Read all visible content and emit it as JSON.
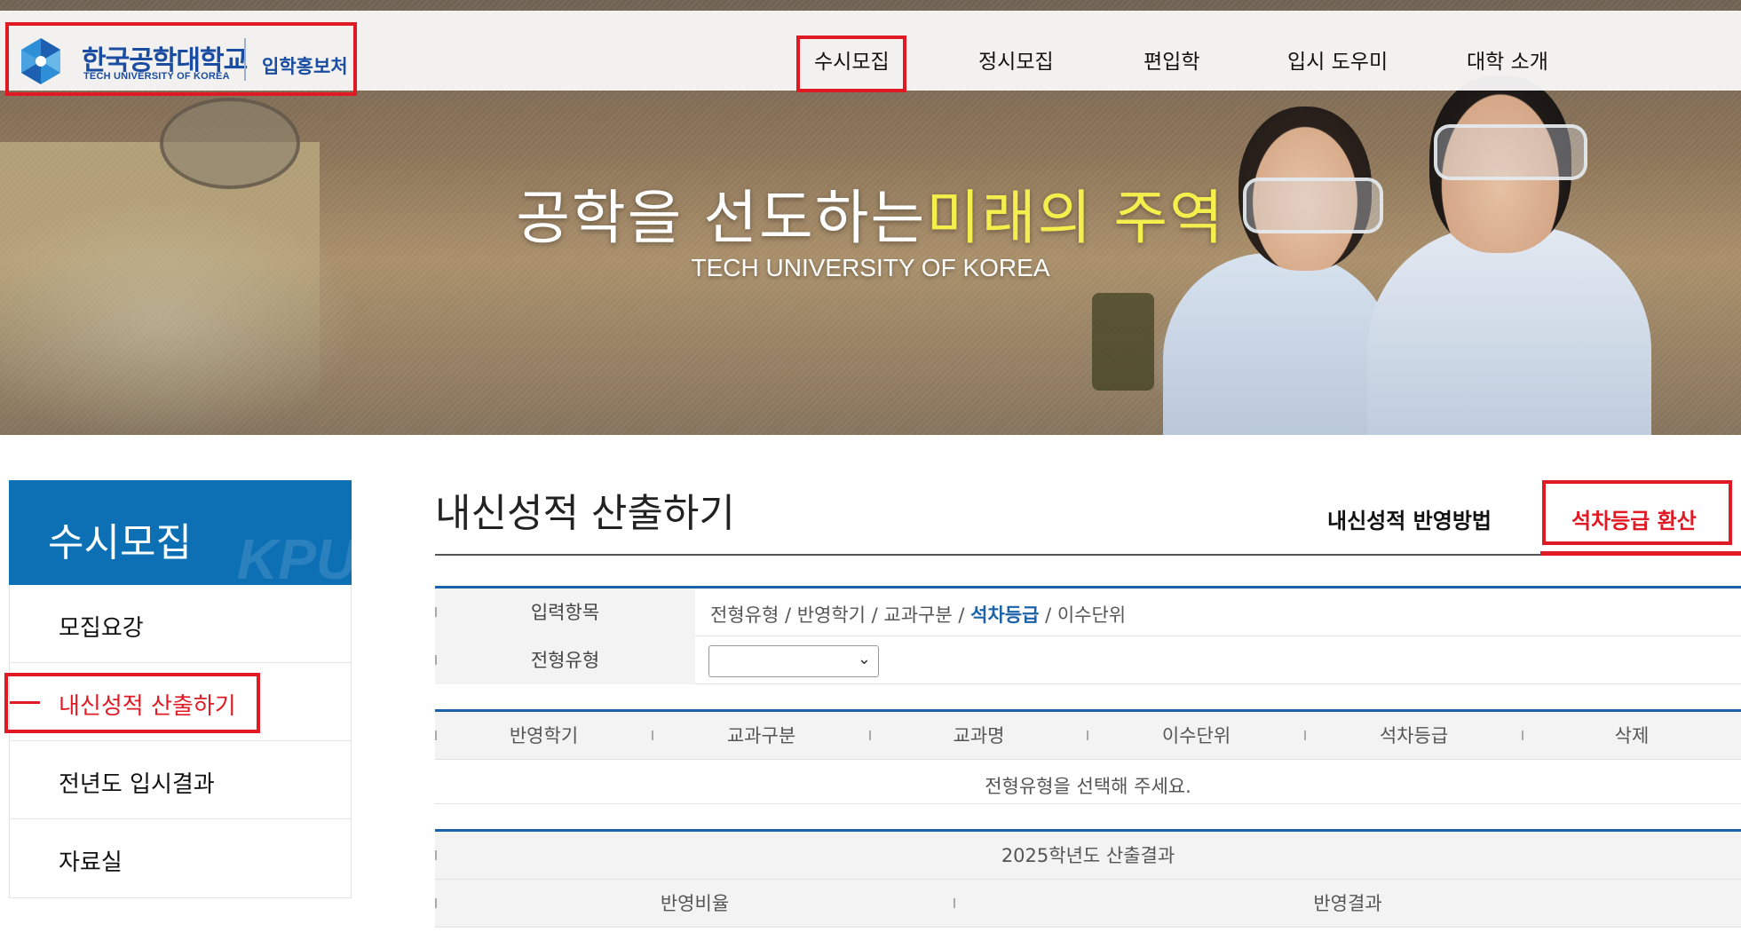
{
  "header": {
    "logo_korean": "한국공학대학교",
    "logo_english": "TECH UNIVERSITY OF KOREA",
    "logo_subtitle": "입학홍보처",
    "nav": [
      "수시모집",
      "정시모집",
      "편입학",
      "입시 도우미",
      "대학 소개"
    ],
    "active_nav": "수시모집"
  },
  "hero": {
    "title_main": "공학을 선도하는",
    "title_highlight": "미래의 주역",
    "subtitle": "TECH UNIVERSITY OF KOREA"
  },
  "sidebar": {
    "title": "수시모집",
    "items": [
      "모집요강",
      "내신성적 산출하기",
      "전년도 입시결과",
      "자료실"
    ],
    "active_item": "내신성적 산출하기"
  },
  "main": {
    "page_title": "내신성적 산출하기",
    "tabs": [
      "내신성적 반영방법",
      "석차등급 환산"
    ],
    "active_tab": "석차등급 환산",
    "input_section": {
      "label_items": "입력항목",
      "steps_before": "전형유형 / 반영학기 / 교과구분 / ",
      "steps_highlight": "석차등급",
      "steps_after": " / 이수단위",
      "label_type": "전형유형",
      "type_selected": ""
    },
    "grade_table": {
      "headers": [
        "반영학기",
        "교과구분",
        "교과명",
        "이수단위",
        "석차등급",
        "삭제"
      ],
      "empty_message": "전형유형을 선택해 주세요."
    },
    "result_table": {
      "title": "2025학년도 산출결과",
      "headers": [
        "반영비율",
        "반영결과"
      ]
    }
  },
  "colors": {
    "primary_blue": "#0d70b5",
    "highlight_red": "#e01a24",
    "hero_yellow": "#f5ef4e"
  }
}
